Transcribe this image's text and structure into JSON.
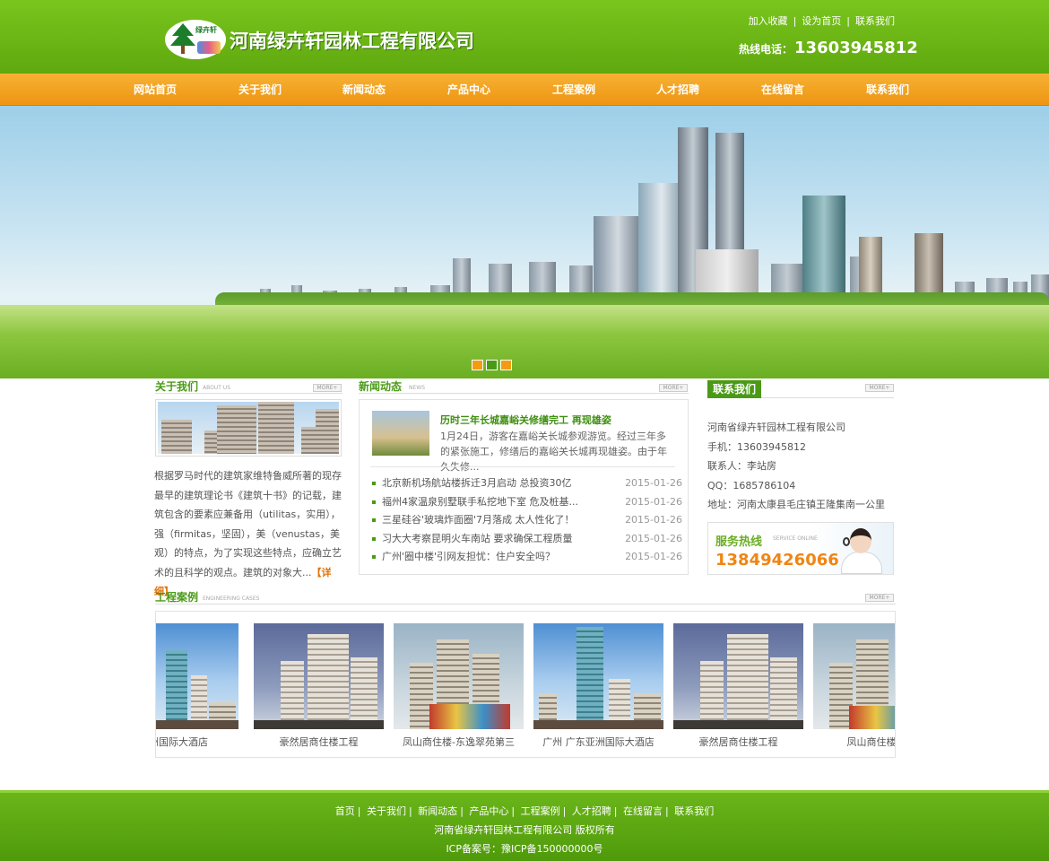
{
  "header": {
    "logo_mini": "绿卉轩",
    "company_name": "河南绿卉轩园林工程有限公司",
    "top_links": [
      "加入收藏",
      "设为首页",
      "联系我们"
    ],
    "hotline_label": "热线电话：",
    "hotline_number": "13603945812"
  },
  "nav": [
    "网站首页",
    "关于我们",
    "新闻动态",
    "产品中心",
    "工程案例",
    "人才招聘",
    "在线留言",
    "联系我们"
  ],
  "banner": {
    "dot_colors": [
      "#f39c12",
      "#4a9a16",
      "#f39c12"
    ]
  },
  "about": {
    "title": "关于我们",
    "subtitle": "ABOUT US",
    "more": "MORE+",
    "text": "根据罗马时代的建筑家维特鲁威所著的现存最早的建筑理论书《建筑十书》的记载，建筑包含的要素应兼备用（utilitas，实用），强（firmitas，坚固），美（venustas，美观）的特点，为了实现这些特点，应确立艺术的且科学的观点。建筑的对象大...",
    "detail": "【详细】"
  },
  "news": {
    "title": "新闻动态",
    "subtitle": "NEWS",
    "more": "MORE+",
    "headline": "历时三年长城嘉峪关修缮完工 再现雄姿",
    "summary": "1月24日，游客在嘉峪关长城参观游览。经过三年多的紧张施工，修缮后的嘉峪关长城再现雄姿。由于年久失修...",
    "items": [
      {
        "title": "北京新机场航站楼拆迁3月启动 总投资30亿",
        "date": "2015-01-26"
      },
      {
        "title": "福州4家温泉别墅联手私挖地下室 危及桩基...",
        "date": "2015-01-26"
      },
      {
        "title": "三星硅谷'玻璃炸面圈'7月落成 太人性化了！",
        "date": "2015-01-26"
      },
      {
        "title": "习大大考察昆明火车南站 要求确保工程质量",
        "date": "2015-01-26"
      },
      {
        "title": "广州'圈中楼'引网友担忧：住户安全吗？",
        "date": "2015-01-26"
      }
    ]
  },
  "contact": {
    "title": "联系我们",
    "more": "MORE+",
    "company": "河南省绿卉轩园林工程有限公司",
    "phone": "手机：13603945812",
    "person": "联系人：李站房",
    "qq": "QQ：1685786104",
    "address": "地址：河南太康县毛庄镇王隆集南一公里",
    "service_title": "服务热线",
    "service_en": "SERVICE ONLINE",
    "service_number": "13849426066"
  },
  "cases": {
    "title": "工程案例",
    "subtitle": "ENGINEERING CASES",
    "more": "MORE+",
    "items": [
      "亚洲国际大酒店",
      "豪然居商住楼工程",
      "凤山商住楼-东逸翠苑第三",
      "广州 广东亚洲国际大酒店",
      "豪然居商住楼工程",
      "凤山商住楼-东"
    ]
  },
  "footer": {
    "links": [
      "首页",
      "关于我们",
      "新闻动态",
      "产品中心",
      "工程案例",
      "人才招聘",
      "在线留言",
      "联系我们"
    ],
    "company": "河南省绿卉轩园林工程有限公司 版权所有",
    "icp": "ICP备案号：豫ICP备150000000号"
  }
}
